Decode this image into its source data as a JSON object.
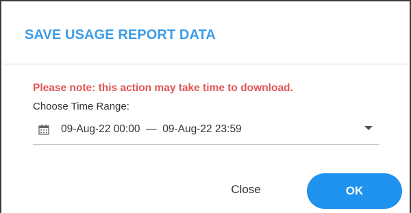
{
  "dialog": {
    "title": "SAVE USAGE REPORT DATA",
    "note": "Please note: this action may take time to download.",
    "range_label": "Choose Time Range:",
    "range_value": "09-Aug-22 00:00  —  09-Aug-22 23:59",
    "close_label": "Close",
    "ok_label": "OK"
  },
  "icons": {
    "calendar": "calendar-icon",
    "dropdown": "chevron-down-icon"
  },
  "colors": {
    "title": "#3b9ce6",
    "note": "#e05656",
    "ok_button": "#1f92ee"
  }
}
